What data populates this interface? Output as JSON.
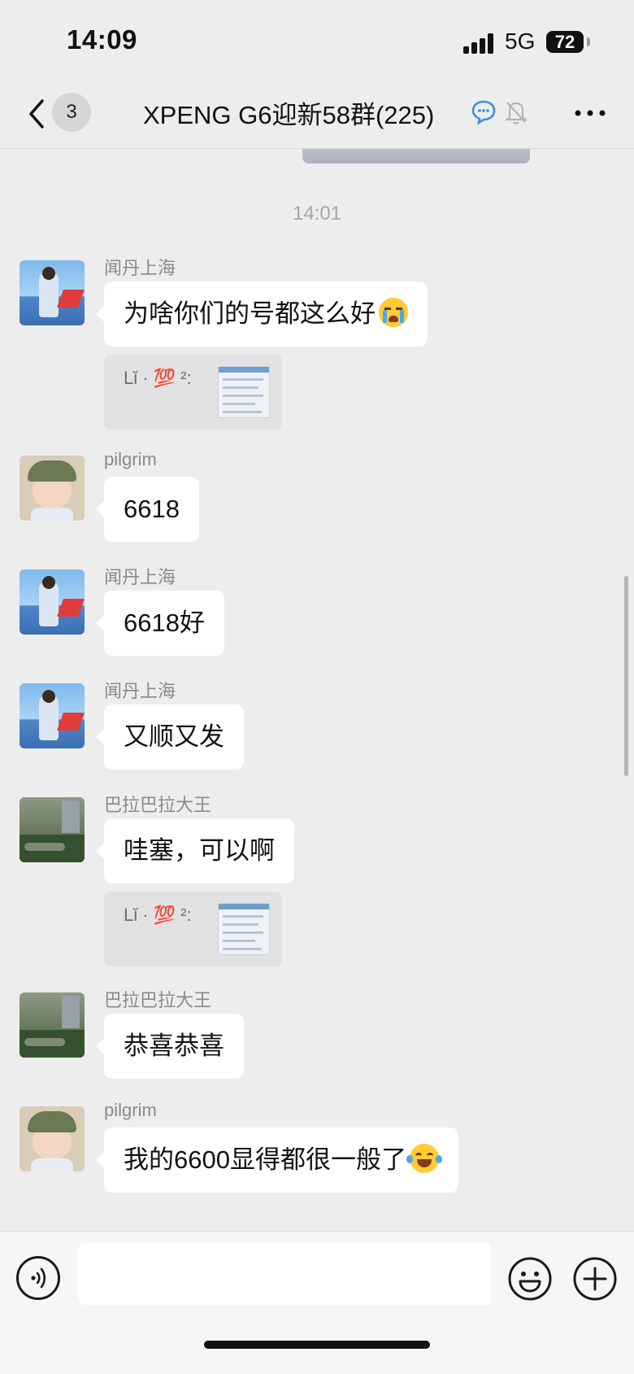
{
  "status_bar": {
    "time": "14:09",
    "network": "5G",
    "battery": "72"
  },
  "nav": {
    "unread_count": "3",
    "title": "XPENG G6迎新58群(225)",
    "icons": [
      "back-chevron-icon",
      "chat-bubble-icon",
      "muted-bell-icon",
      "more-dots-icon"
    ]
  },
  "chat": {
    "time_divider": "14:01",
    "messages": [
      {
        "sender": "闻丹上海",
        "text": "为啥你们的号都这么好",
        "emoji": "loudly-crying-face",
        "quote": "Lǐ · 💯 ²:"
      },
      {
        "sender": "pilgrim",
        "text": "6618"
      },
      {
        "sender": "闻丹上海",
        "text": "6618好"
      },
      {
        "sender": "闻丹上海",
        "text": "又顺又发"
      },
      {
        "sender": "巴拉巴拉大王",
        "text": "哇塞，可以啊",
        "quote": "Lǐ · 💯 ²:"
      },
      {
        "sender": "巴拉巴拉大王",
        "text": "恭喜恭喜"
      },
      {
        "sender": "pilgrim",
        "text": "我的6600显得都很一般了",
        "emoji": "face-with-tears-of-joy"
      }
    ]
  },
  "input_bar": {
    "placeholder": "",
    "icons": [
      "voice-icon",
      "emoji-icon",
      "plus-icon"
    ]
  },
  "colors": {
    "background": "#ededed",
    "bubble": "#ffffff",
    "meta_text": "#8a8a8a",
    "accent": "#1e88e5"
  }
}
